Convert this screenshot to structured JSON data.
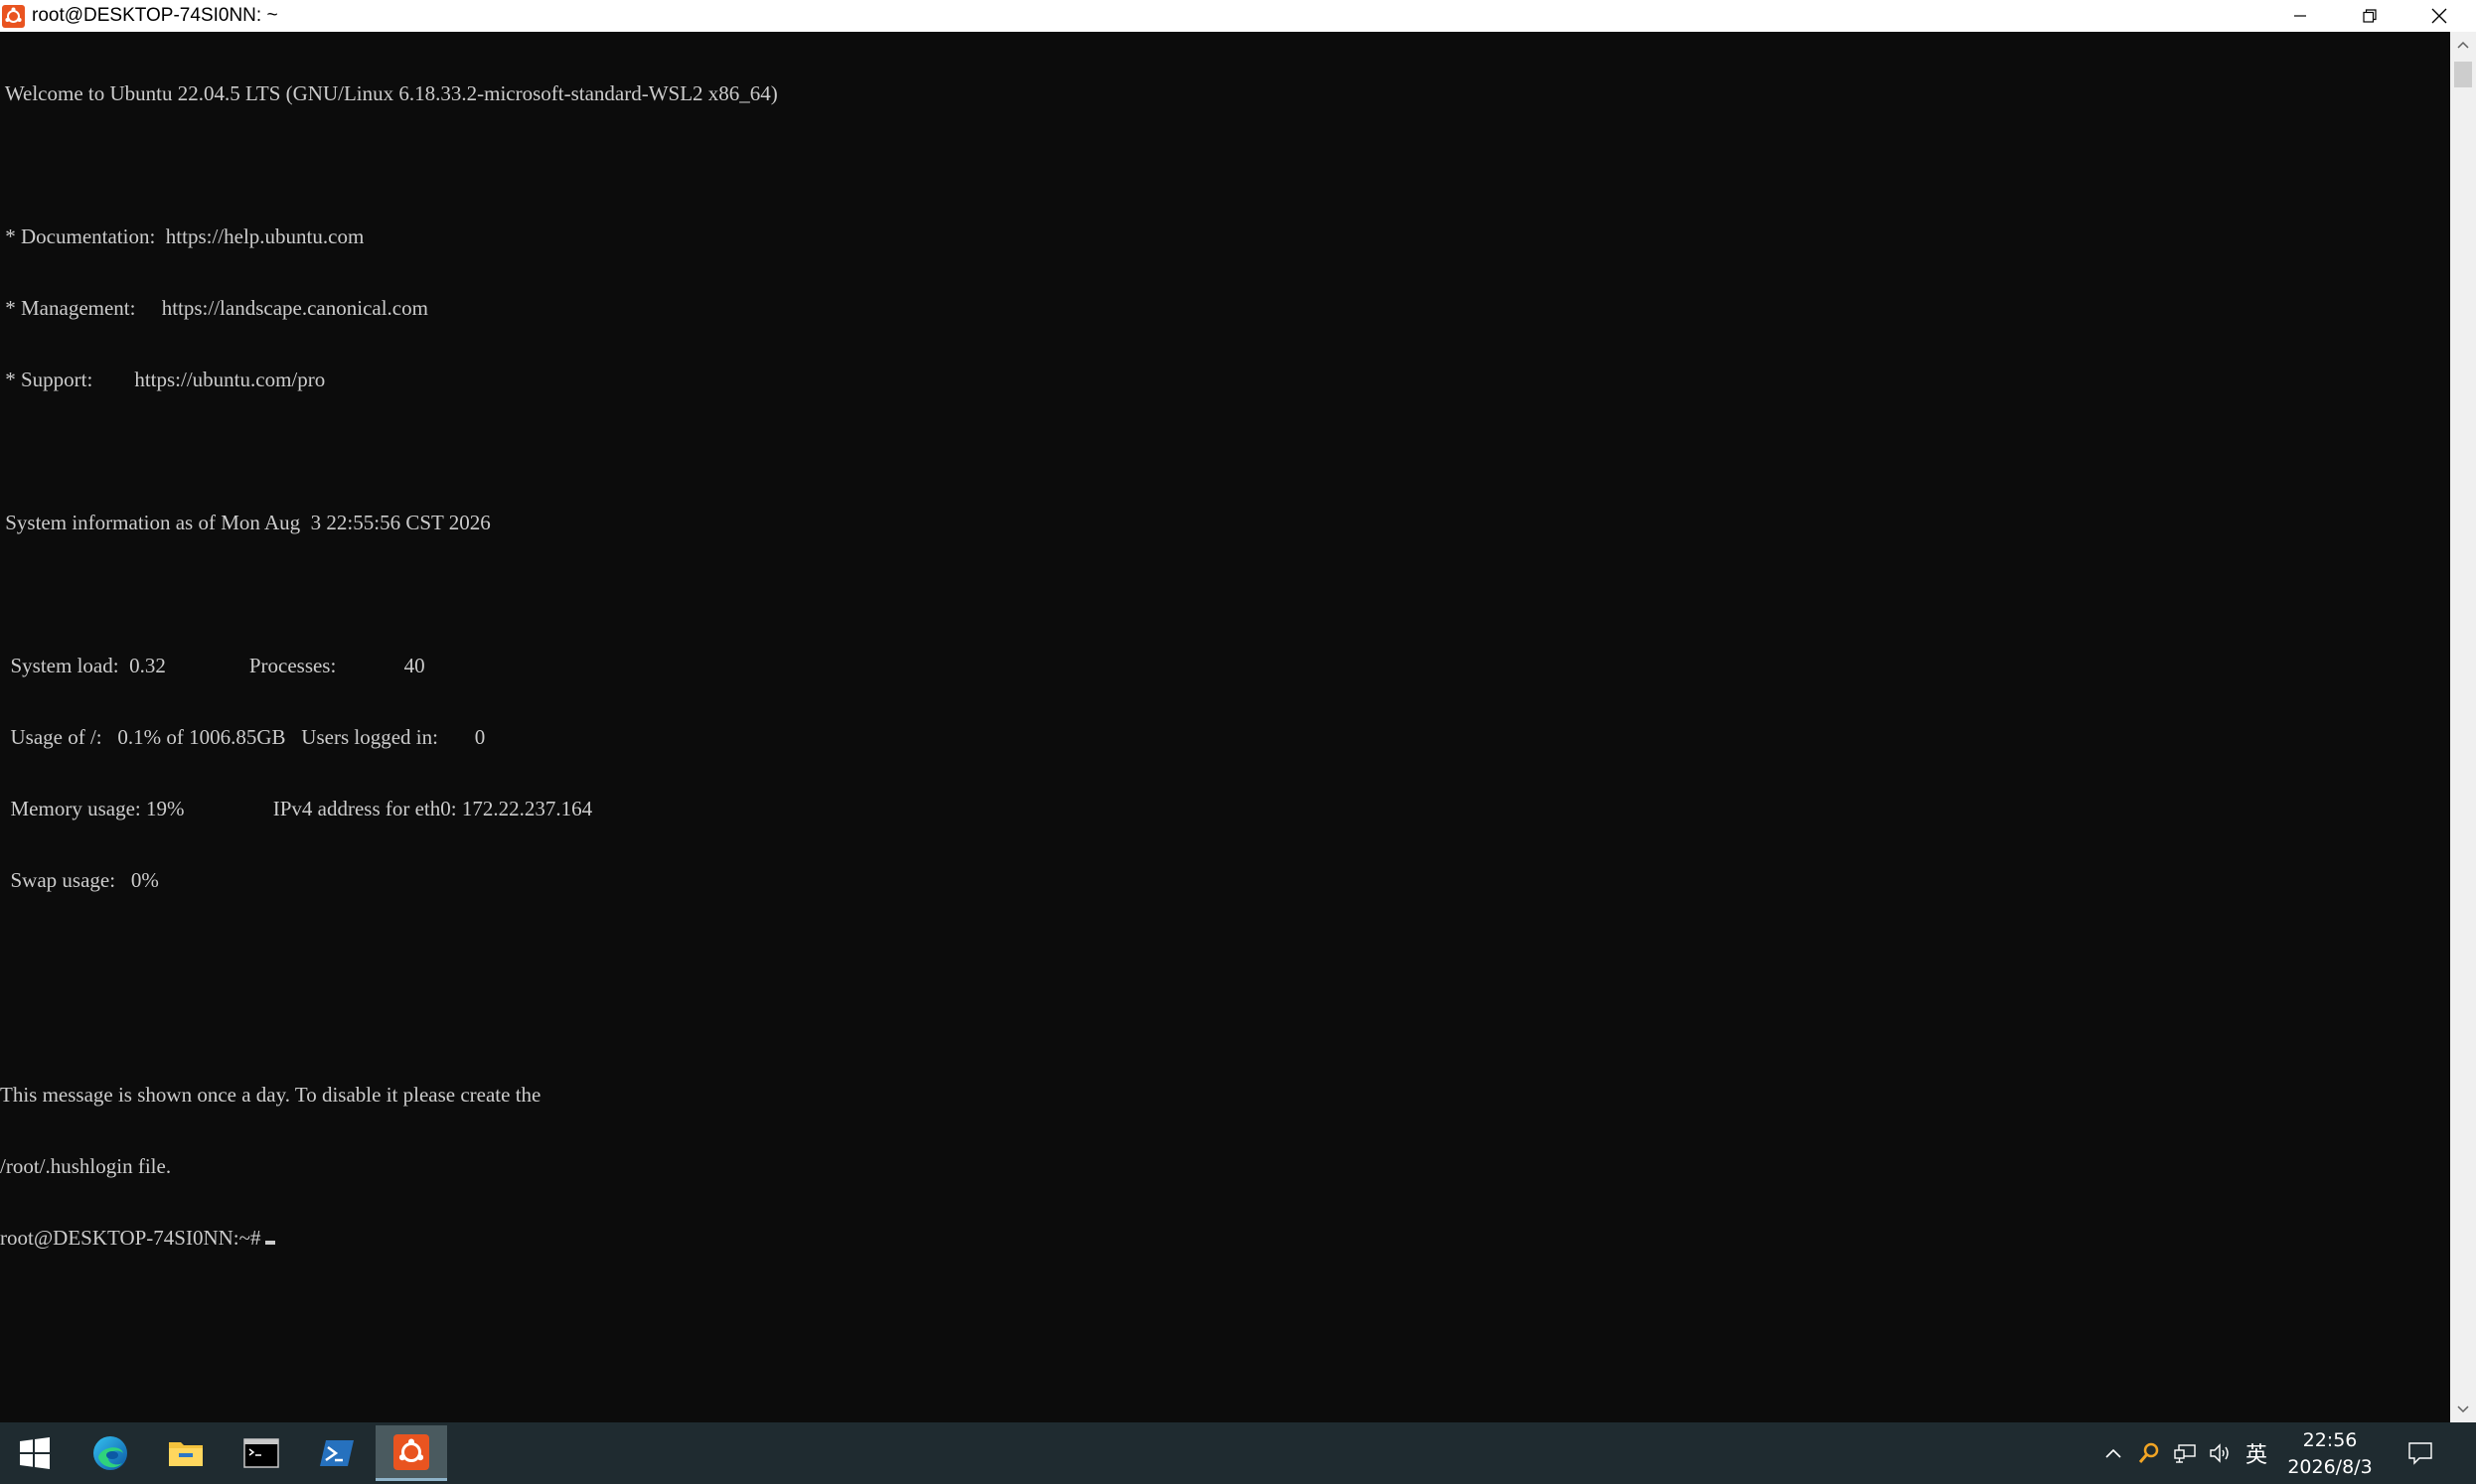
{
  "window": {
    "title": "root@DESKTOP-74SI0NN: ~",
    "icon": "ubuntu-icon"
  },
  "terminal": {
    "lines": [
      " Welcome to Ubuntu 22.04.5 LTS (GNU/Linux 6.18.33.2-microsoft-standard-WSL2 x86_64)",
      "",
      " * Documentation:  https://help.ubuntu.com",
      " * Management:     https://landscape.canonical.com",
      " * Support:        https://ubuntu.com/pro",
      "",
      " System information as of Mon Aug  3 22:55:56 CST 2026",
      "",
      "  System load:  0.32                Processes:             40",
      "  Usage of /:   0.1% of 1006.85GB   Users logged in:       0",
      "  Memory usage: 19%                 IPv4 address for eth0: 172.22.237.164",
      "  Swap usage:   0%",
      "",
      "",
      "This message is shown once a day. To disable it please create the",
      "/root/.hushlogin file."
    ],
    "prompt": "root@DESKTOP-74SI0NN:~#"
  },
  "taskbar": {
    "apps": [
      {
        "name": "start-icon"
      },
      {
        "name": "edge-icon"
      },
      {
        "name": "file-explorer-icon"
      },
      {
        "name": "command-prompt-icon"
      },
      {
        "name": "powershell-icon"
      },
      {
        "name": "ubuntu-icon",
        "active": true
      }
    ],
    "tray": {
      "input_method": "英",
      "time": "22:56",
      "date": "2026/8/3"
    }
  },
  "colors": {
    "terminal_bg": "#0c0c0c",
    "terminal_fg": "#cccccc",
    "taskbar_bg": "#1f2b30",
    "ubuntu_orange": "#e95420"
  }
}
